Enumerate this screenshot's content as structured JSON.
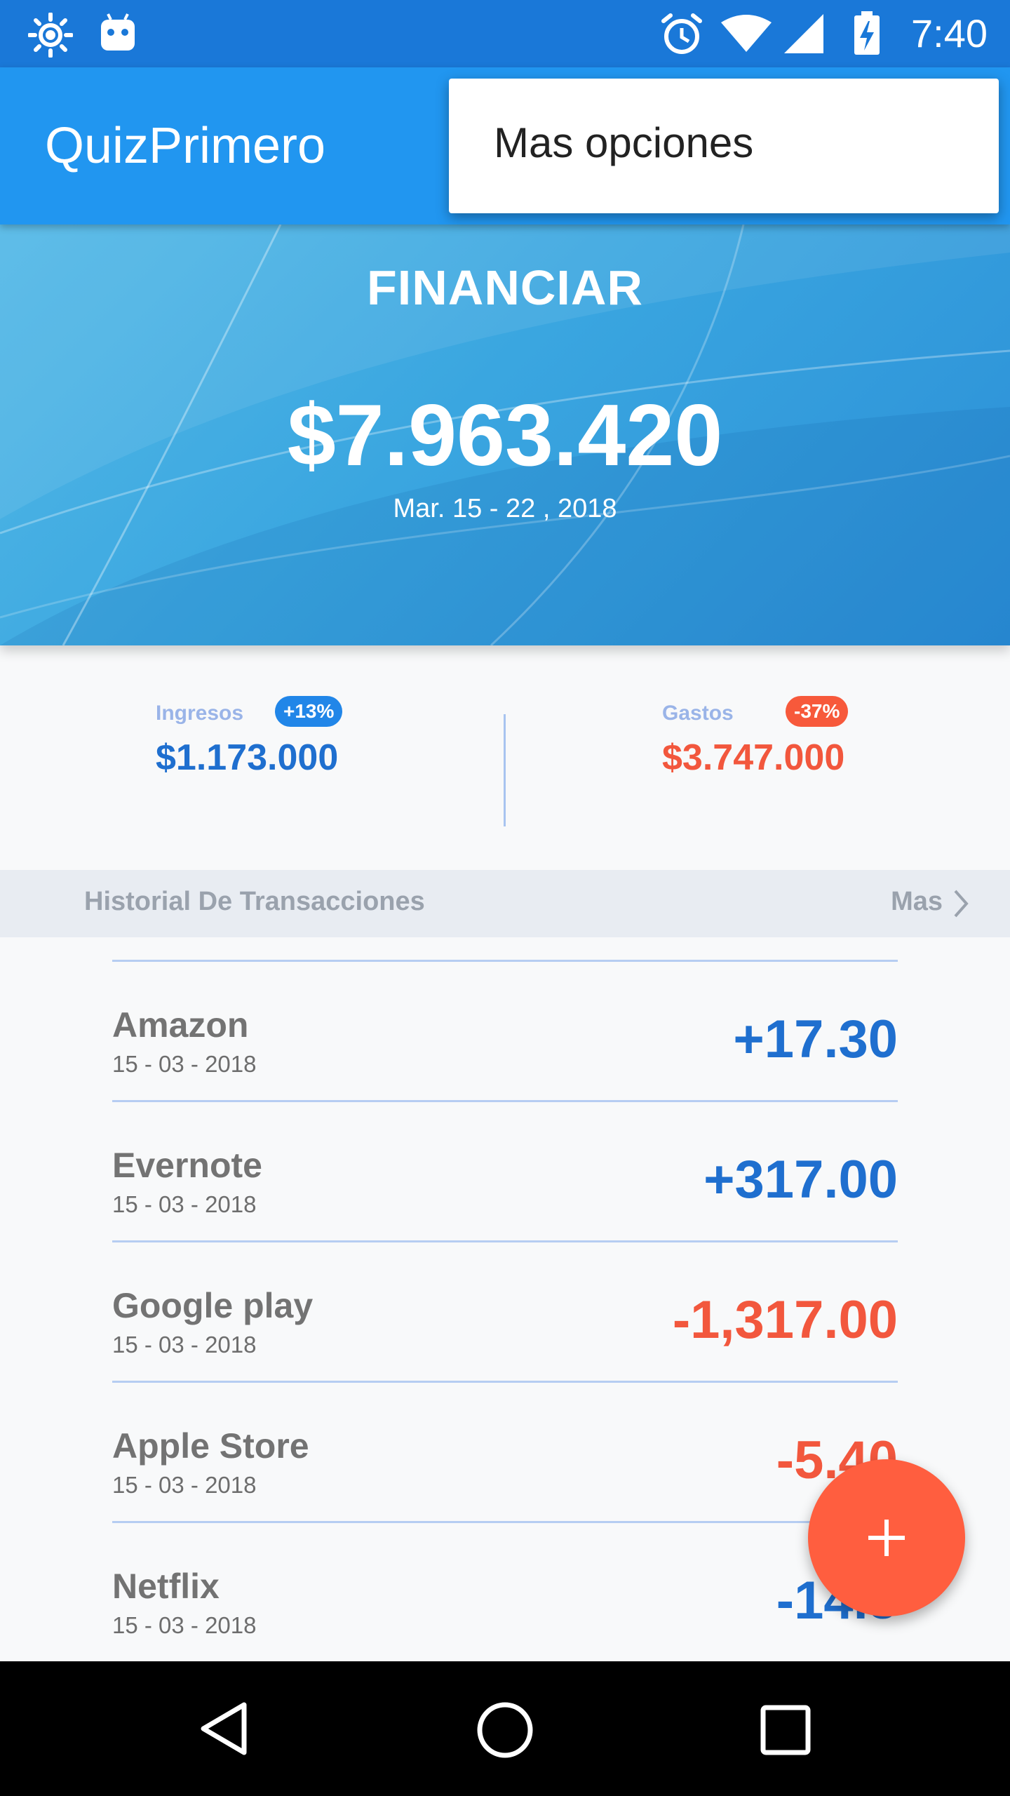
{
  "status_bar": {
    "time": "7:40",
    "icons": [
      "brightness-icon",
      "android-icon",
      "alarm-icon",
      "wifi-icon",
      "signal-icon",
      "battery-charging-icon"
    ]
  },
  "app_bar": {
    "title": "QuizPrimero"
  },
  "overflow_menu": {
    "items": [
      "Mas opciones"
    ]
  },
  "banner": {
    "title": "FINANCIAR",
    "amount": "$7.963.420",
    "date_range": "Mar. 15 - 22 , 2018"
  },
  "summary": {
    "income": {
      "label": "Ingresos",
      "badge": "+13%",
      "value": "$1.173.000",
      "color": "#1f6fcf",
      "badge_color": "#2186e8"
    },
    "expenses": {
      "label": "Gastos",
      "badge": "-37%",
      "value": "$3.747.000",
      "color": "#f2573d",
      "badge_color": "#f7593b"
    }
  },
  "history": {
    "title": "Historial De Transacciones",
    "more_label": "Mas"
  },
  "transactions": [
    {
      "name": "Amazon",
      "date": "15 - 03 - 2018",
      "amount": "+17.30",
      "kind": "income"
    },
    {
      "name": "Evernote",
      "date": "15 - 03 - 2018",
      "amount": "+317.00",
      "kind": "income"
    },
    {
      "name": "Google play",
      "date": "15 - 03 - 2018",
      "amount": "-1,317.00",
      "kind": "expense"
    },
    {
      "name": "Apple Store",
      "date": "15 - 03 - 2018",
      "amount": "-5.40",
      "kind": "expense"
    },
    {
      "name": "Netflix",
      "date": "15 - 03 - 2018",
      "amount": "-14.5",
      "kind": "income"
    }
  ],
  "colors": {
    "income": "#1f6fcf",
    "expense": "#f2573d",
    "fab": "#ff5e3f",
    "primary": "#2196f0"
  },
  "fab": {
    "icon": "plus-icon"
  },
  "nav_bar": {
    "icons": [
      "back-icon",
      "home-icon",
      "recents-icon"
    ]
  }
}
